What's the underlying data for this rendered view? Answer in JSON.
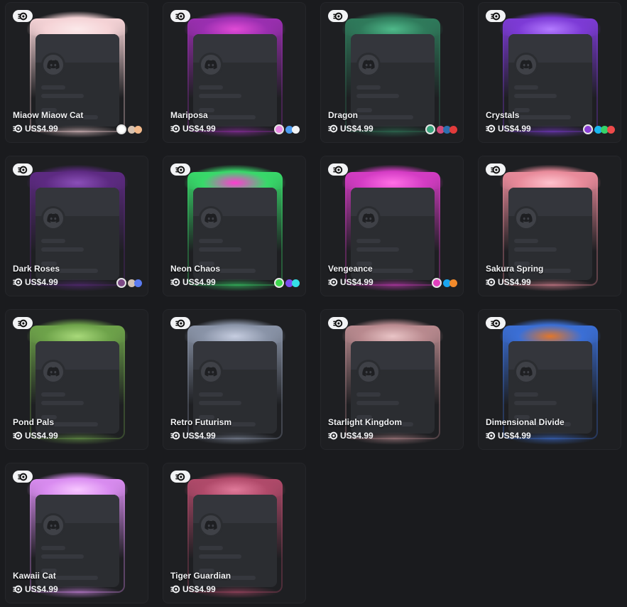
{
  "shop": {
    "currency_icon": "orb-icon",
    "badge_icon": "nitro-icon",
    "items": [
      {
        "name": "Miaow Miaow Cat",
        "price": "US$4.99",
        "frame_color": "#f5d3d6",
        "accent": "#fbe9ea",
        "swatches": [
          "#ffffff",
          "#d8c2b0",
          "#f2b98b"
        ]
      },
      {
        "name": "Mariposa",
        "price": "US$4.99",
        "frame_color": "#9a2fb0",
        "accent": "#e14bd6",
        "swatches": [
          "#e887e2",
          "#4d9cf0",
          "#f2f3f5"
        ]
      },
      {
        "name": "Dragon",
        "price": "US$4.99",
        "frame_color": "#2f7a5b",
        "accent": "#4fb98a",
        "swatches": [
          "#3aa37c",
          "#d24a79",
          "#2d6fb0",
          "#e23b3b"
        ]
      },
      {
        "name": "Crystals",
        "price": "US$4.99",
        "frame_color": "#7d3bd6",
        "accent": "#b37bff",
        "swatches": [
          "#8b3fd6",
          "#19b8f0",
          "#36d36a",
          "#ee4a4a"
        ]
      },
      {
        "name": "Dark Roses",
        "price": "US$4.99",
        "frame_color": "#5d2a82",
        "accent": "#8a4fb8",
        "swatches": [
          "#7d4a86",
          "#d3c2b5",
          "#5b7bf0"
        ]
      },
      {
        "name": "Neon Chaos",
        "price": "US$4.99",
        "frame_color": "#38d96a",
        "accent": "#ff3bd2",
        "swatches": [
          "#3fd74e",
          "#7c4ff0",
          "#35e0e8"
        ]
      },
      {
        "name": "Vengeance",
        "price": "US$4.99",
        "frame_color": "#d43cc4",
        "accent": "#ff6fe6",
        "swatches": [
          "#e23fbe",
          "#1aa6f0",
          "#f28a2b"
        ]
      },
      {
        "name": "Sakura Spring",
        "price": "US$4.99",
        "frame_color": "#e88a9a",
        "accent": "#ffc2cd",
        "swatches": []
      },
      {
        "name": "Pond Pals",
        "price": "US$4.99",
        "frame_color": "#6ea34a",
        "accent": "#a8d97a",
        "swatches": []
      },
      {
        "name": "Retro Futurism",
        "price": "US$4.99",
        "frame_color": "#8a94a8",
        "accent": "#c6cde0",
        "swatches": []
      },
      {
        "name": "Starlight Kingdom",
        "price": "US$4.99",
        "frame_color": "#b98a8f",
        "accent": "#e9c4c6",
        "swatches": []
      },
      {
        "name": "Dimensional Divide",
        "price": "US$4.99",
        "frame_color": "#3b6fd6",
        "accent": "#e2762a",
        "swatches": []
      },
      {
        "name": "Kawaii Cat",
        "price": "US$4.99",
        "frame_color": "#d98cf0",
        "accent": "#f7c7ff",
        "swatches": []
      },
      {
        "name": "Tiger Guardian",
        "price": "US$4.99",
        "frame_color": "#b04a6a",
        "accent": "#e07a9a",
        "swatches": []
      }
    ]
  }
}
